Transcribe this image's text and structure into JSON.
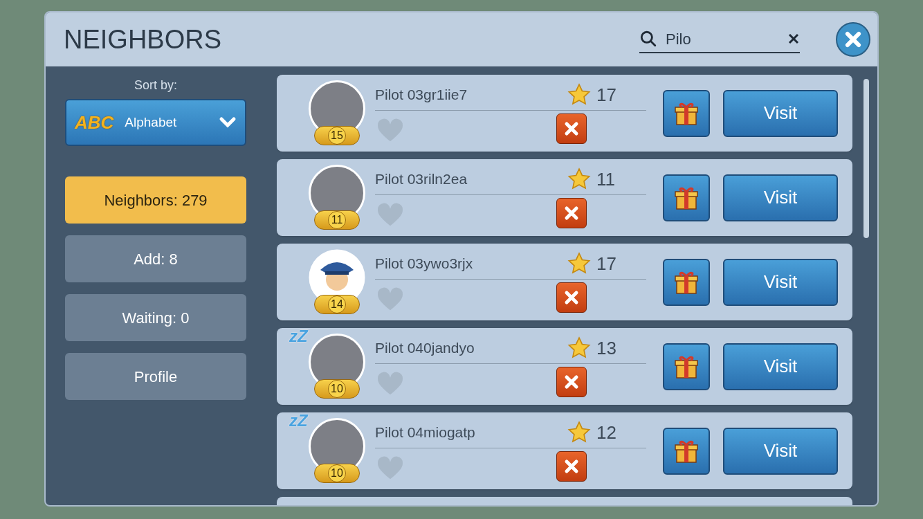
{
  "dialog": {
    "title": "NEIGHBORS"
  },
  "search": {
    "value": "Pilo"
  },
  "sort": {
    "label": "Sort by:",
    "icon": "ABC",
    "value": "Alphabet"
  },
  "tabs": [
    {
      "label": "Neighbors: 279",
      "selected": true
    },
    {
      "label": "Add: 8",
      "selected": false
    },
    {
      "label": "Waiting: 0",
      "selected": false
    },
    {
      "label": "Profile",
      "selected": false
    }
  ],
  "neighbors": [
    {
      "name": "Pilot 03gr1iie7",
      "level": "15",
      "score": "17",
      "kind": "photo",
      "liked": false,
      "action": "Visit"
    },
    {
      "name": "Pilot 03riln2ea",
      "level": "11",
      "score": "11",
      "kind": "photo",
      "liked": false,
      "action": "Visit"
    },
    {
      "name": "Pilot 03ywo3rjx",
      "level": "14",
      "score": "17",
      "kind": "pilot",
      "liked": false,
      "action": "Visit"
    },
    {
      "name": "Pilot 040jandyo",
      "level": "10",
      "score": "13",
      "kind": "photo",
      "sleep_badge": "zZ",
      "liked": false,
      "action": "Visit"
    },
    {
      "name": "Pilot 04miogatp",
      "level": "10",
      "score": "12",
      "kind": "photo",
      "sleep_badge": "zZ",
      "liked": false,
      "action": "Visit"
    }
  ]
}
